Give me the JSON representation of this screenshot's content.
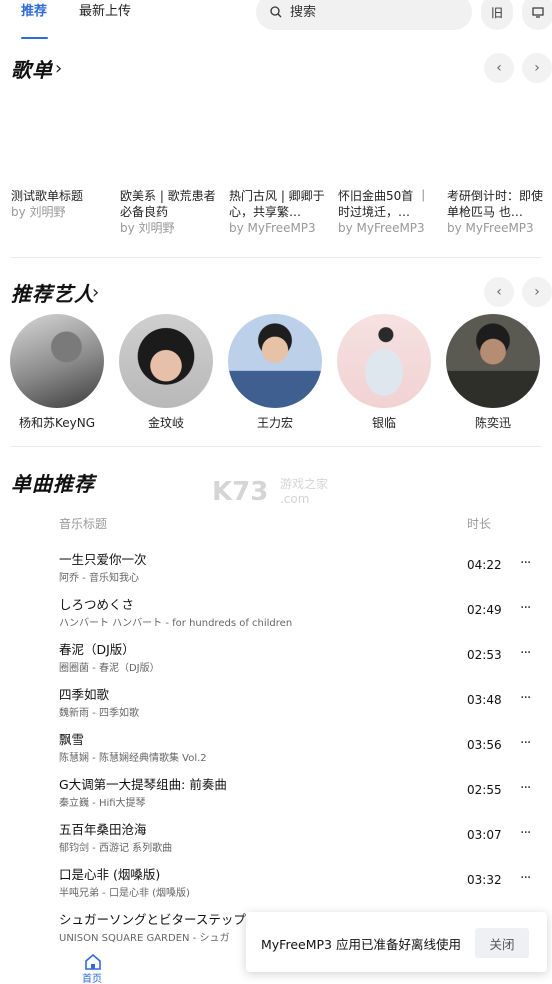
{
  "top_tabs": {
    "recommended": "推荐",
    "latest": "最新上传"
  },
  "search": {
    "placeholder": "搜索"
  },
  "top_buttons": {
    "old": "旧"
  },
  "playlists": {
    "title": "歌单",
    "items": [
      {
        "title": "测试歌单标题",
        "by": "by 刘明野"
      },
      {
        "title": "欧美系 | 歌荒患者必备良药",
        "by": "by 刘明野"
      },
      {
        "title": "热门古风 | 卿卿于心，共享繁…",
        "by": "by MyFreeMP3"
      },
      {
        "title": "怀旧金曲50首 ｜时过境迁，…",
        "by": "by MyFreeMP3"
      },
      {
        "title": "考研倒计时：即使单枪匹马 也…",
        "by": "by MyFreeMP3"
      }
    ]
  },
  "artists": {
    "title": "推荐艺人",
    "items": [
      {
        "name": "杨和苏KeyNG"
      },
      {
        "name": "金玟岐"
      },
      {
        "name": "王力宏"
      },
      {
        "name": "银临"
      },
      {
        "name": "陈奕迅"
      }
    ]
  },
  "songs": {
    "title": "单曲推荐",
    "col_title": "音乐标题",
    "col_duration": "时长",
    "items": [
      {
        "title": "一生只爱你一次",
        "sub": "阿乔 - 音乐知我心",
        "time": "04:22"
      },
      {
        "title": "しろつめくさ",
        "sub": "ハンバート ハンバート - for hundreds of children",
        "time": "02:49"
      },
      {
        "title": "春泥（DJ版）",
        "sub": "圈圈菌 - 春泥（DJ版）",
        "time": "02:53"
      },
      {
        "title": "四季如歌",
        "sub": "魏新雨 - 四季如歌",
        "time": "03:48"
      },
      {
        "title": "飘雪",
        "sub": "陈慧娴 - 陈慧娴经典情歌集 Vol.2",
        "time": "03:56"
      },
      {
        "title": "G大调第一大提琴组曲: 前奏曲",
        "sub": "秦立巍 - Hifi大提琴",
        "time": "02:55"
      },
      {
        "title": "五百年桑田沧海",
        "sub": "郁钧剑 - 西游记 系列歌曲",
        "time": "03:07"
      },
      {
        "title": "口是心非 (烟嗓版)",
        "sub": "半吨兄弟 - 口是心非 (烟嗓版)",
        "time": "03:32"
      },
      {
        "title": "シュガーソングとビターステップ",
        "sub": "UNISON SQUARE GARDEN - シュガ",
        "time": ""
      }
    ]
  },
  "watermark": {
    "text": "K73",
    "sub": "游戏之家",
    "domain": ".com"
  },
  "bottom_nav": {
    "home": "首页"
  },
  "toast": {
    "message": "MyFreeMP3 应用已准备好离线使用",
    "close": "关闭"
  },
  "colors": {
    "accent": "#2f6bd8"
  }
}
